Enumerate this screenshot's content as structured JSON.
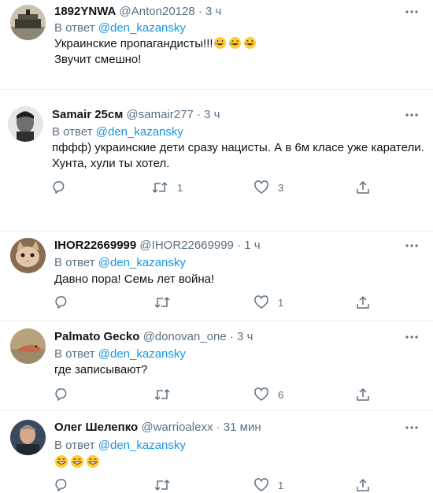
{
  "tweets": [
    {
      "name": "1892YNWA",
      "handle": "@Anton20128",
      "time": "· 3 ч",
      "reply_prefix": "В ответ",
      "reply_to": "@den_kazansky",
      "body": [
        "Украинские пропагандисты!!!",
        "Звучит смешно!"
      ],
      "emoji": "rolling-on-floor-laughing",
      "retweets": "",
      "likes": "",
      "avatar": "monument-photo"
    },
    {
      "name": "Samair 25см",
      "handle": "@samair277",
      "time": "· 3 ч",
      "reply_prefix": "В ответ",
      "reply_to": "@den_kazansky",
      "body": [
        "пффф) украинские дети сразу нацисты. А в 6м класе уже каратели.",
        "Хунта, хули ты хотел."
      ],
      "retweets": "1",
      "likes": "3",
      "avatar": "man-photo"
    },
    {
      "name": "IHOR22669999",
      "handle": "@IHOR22669999",
      "time": "· 1 ч",
      "reply_prefix": "В ответ",
      "reply_to": "@den_kazansky",
      "body": [
        "Давно пора! Семь лет война!"
      ],
      "retweets": "",
      "likes": "1",
      "avatar": "cat-photo"
    },
    {
      "name": "Palmato Gecko",
      "handle": "@donovan_one",
      "time": "· 3 ч",
      "reply_prefix": "В ответ",
      "reply_to": "@den_kazansky",
      "body": [
        "где записывают?"
      ],
      "retweets": "",
      "likes": "6",
      "avatar": "gecko-photo"
    },
    {
      "name": "Олег Шелепко",
      "handle": "@warrioalexx",
      "time": "· 31 мин",
      "reply_prefix": "В ответ",
      "reply_to": "@den_kazansky",
      "body": [],
      "emoji": "grinning-face-with-smiling-eyes",
      "retweets": "",
      "likes": "1",
      "avatar": "man-photo"
    }
  ],
  "colors": {
    "link": "#1b95e0",
    "muted": "#5b7083",
    "text": "#0f1419",
    "separator": "#ebeef0"
  },
  "icons": [
    "reply-icon",
    "retweet-icon",
    "like-icon",
    "share-icon",
    "more-icon"
  ]
}
